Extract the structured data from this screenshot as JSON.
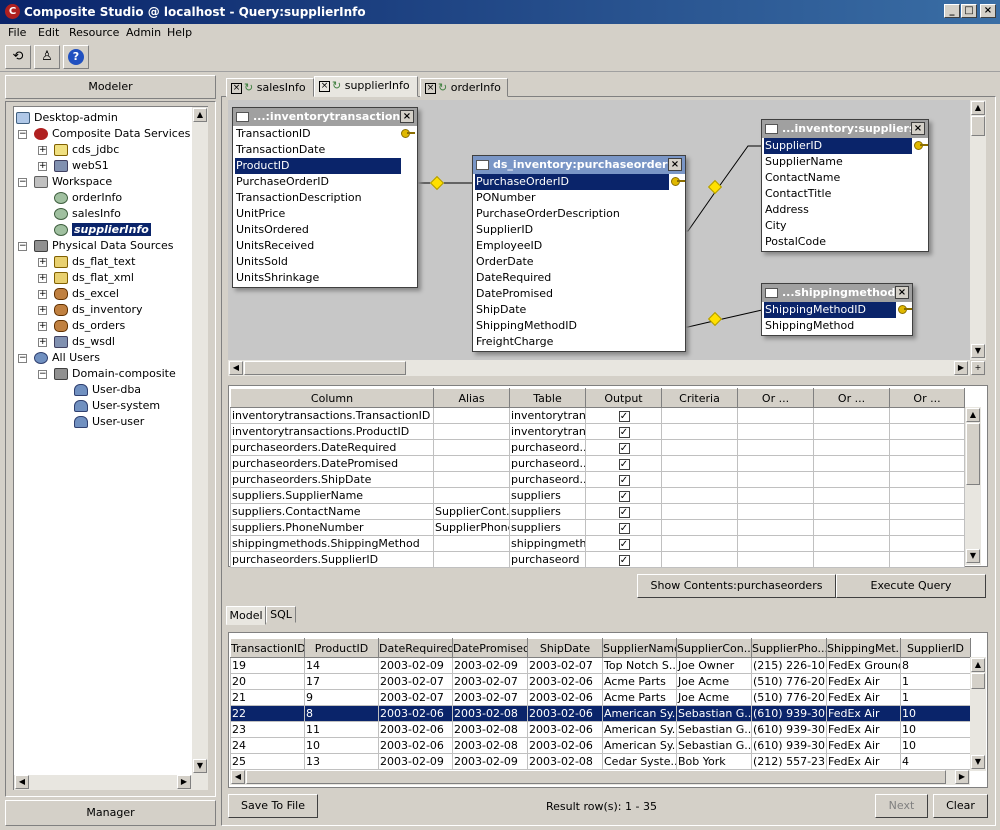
{
  "window": {
    "title": "Composite Studio @ localhost - Query:supplierInfo",
    "app_icon": "C"
  },
  "menu": [
    "File",
    "Edit",
    "Resource",
    "Admin",
    "Help"
  ],
  "left": {
    "modeler_label": "Modeler",
    "manager_label": "Manager",
    "tree": [
      {
        "label": "Desktop-admin",
        "icon": "desktop-icon"
      },
      {
        "label": "Composite Data Services",
        "icon": "composite-icon"
      },
      {
        "label": "cds_jdbc",
        "icon": "cds-icon"
      },
      {
        "label": "webS1",
        "icon": "soap-icon"
      },
      {
        "label": "Workspace",
        "icon": "workspace-icon"
      },
      {
        "label": "orderInfo",
        "icon": "query-icon"
      },
      {
        "label": "salesInfo",
        "icon": "query-icon"
      },
      {
        "label": "supplierInfo",
        "icon": "query-icon"
      },
      {
        "label": "Physical Data Sources",
        "icon": "datasources-icon"
      },
      {
        "label": "ds_flat_text",
        "icon": "file-icon"
      },
      {
        "label": "ds_flat_xml",
        "icon": "file-icon"
      },
      {
        "label": "ds_excel",
        "icon": "database-icon"
      },
      {
        "label": "ds_inventory",
        "icon": "database-icon"
      },
      {
        "label": "ds_orders",
        "icon": "database-icon"
      },
      {
        "label": "ds_wsdl",
        "icon": "soap-icon"
      },
      {
        "label": "All Users",
        "icon": "users-icon"
      },
      {
        "label": "Domain-composite",
        "icon": "domain-icon"
      },
      {
        "label": "User-dba",
        "icon": "user-icon"
      },
      {
        "label": "User-system",
        "icon": "user-icon"
      },
      {
        "label": "User-user",
        "icon": "user-icon"
      }
    ]
  },
  "tabs": [
    "salesInfo",
    "supplierInfo",
    "orderInfo"
  ],
  "diagram": {
    "t1": {
      "title": "...:inventorytransactions",
      "rows": [
        "TransactionID",
        "TransactionDate",
        "ProductID",
        "PurchaseOrderID",
        "TransactionDescription",
        "UnitPrice",
        "UnitsOrdered",
        "UnitsReceived",
        "UnitsSold",
        "UnitsShrinkage"
      ]
    },
    "t2": {
      "title": "ds_inventory:purchaseorders",
      "rows": [
        "PurchaseOrderID",
        "PONumber",
        "PurchaseOrderDescription",
        "SupplierID",
        "EmployeeID",
        "OrderDate",
        "DateRequired",
        "DatePromised",
        "ShipDate",
        "ShippingMethodID",
        "FreightCharge"
      ]
    },
    "t3": {
      "title": "...inventory:suppliers",
      "rows": [
        "SupplierID",
        "SupplierName",
        "ContactName",
        "ContactTitle",
        "Address",
        "City",
        "PostalCode"
      ]
    },
    "t4": {
      "title": "...shippingmethods",
      "rows": [
        "ShippingMethodID",
        "ShippingMethod"
      ]
    }
  },
  "query_grid": {
    "headers": [
      "Column",
      "Alias",
      "Table",
      "Output",
      "Criteria",
      "Or ...",
      "Or ...",
      "Or ..."
    ],
    "rows": [
      [
        "inventorytransactions.TransactionID",
        "",
        "inventorytran..."
      ],
      [
        "inventorytransactions.ProductID",
        "",
        "inventorytran..."
      ],
      [
        "purchaseorders.DateRequired",
        "",
        "purchaseord..."
      ],
      [
        "purchaseorders.DatePromised",
        "",
        "purchaseord..."
      ],
      [
        "purchaseorders.ShipDate",
        "",
        "purchaseord..."
      ],
      [
        "suppliers.SupplierName",
        "",
        "suppliers"
      ],
      [
        "suppliers.ContactName",
        "SupplierCont...",
        "suppliers"
      ],
      [
        "suppliers.PhoneNumber",
        "SupplierPhone",
        "suppliers"
      ],
      [
        "shippingmethods.ShippingMethod",
        "",
        "shippingmeth..."
      ],
      [
        "purchaseorders.SupplierID",
        "",
        "purchaseord"
      ]
    ]
  },
  "buttons": {
    "show_contents": "Show Contents:purchaseorders",
    "execute": "Execute Query",
    "save": "Save To File",
    "next": "Next",
    "clear": "Clear"
  },
  "subtabs": [
    "Model",
    "SQL"
  ],
  "results": {
    "headers": [
      "TransactionID",
      "ProductID",
      "DateRequired",
      "DatePromised",
      "ShipDate",
      "SupplierName",
      "SupplierCon...",
      "SupplierPho...",
      "ShippingMet...",
      "SupplierID"
    ],
    "rows": [
      [
        "19",
        "14",
        "2003-02-09",
        "2003-02-09",
        "2003-02-07",
        "Top Notch S...",
        "Joe Owner",
        "(215) 226-10...",
        "FedEx Ground",
        "8"
      ],
      [
        "20",
        "17",
        "2003-02-07",
        "2003-02-07",
        "2003-02-06",
        "Acme Parts",
        "Joe Acme",
        "(510) 776-20...",
        "FedEx Air",
        "1"
      ],
      [
        "21",
        "9",
        "2003-02-07",
        "2003-02-07",
        "2003-02-06",
        "Acme Parts",
        "Joe Acme",
        "(510) 776-20...",
        "FedEx Air",
        "1"
      ],
      [
        "22",
        "8",
        "2003-02-06",
        "2003-02-08",
        "2003-02-06",
        "American Sy...",
        "Sebastian G...",
        "(610) 939-30...",
        "FedEx Air",
        "10"
      ],
      [
        "23",
        "11",
        "2003-02-06",
        "2003-02-08",
        "2003-02-06",
        "American Sy...",
        "Sebastian G...",
        "(610) 939-30...",
        "FedEx Air",
        "10"
      ],
      [
        "24",
        "10",
        "2003-02-06",
        "2003-02-08",
        "2003-02-06",
        "American Sy...",
        "Sebastian G...",
        "(610) 939-30...",
        "FedEx Air",
        "10"
      ],
      [
        "25",
        "13",
        "2003-02-09",
        "2003-02-09",
        "2003-02-08",
        "Cedar Syste...",
        "Bob York",
        "(212) 557-23...",
        "FedEx Air",
        "4"
      ]
    ],
    "status": "Result row(s): 1 - 35"
  }
}
